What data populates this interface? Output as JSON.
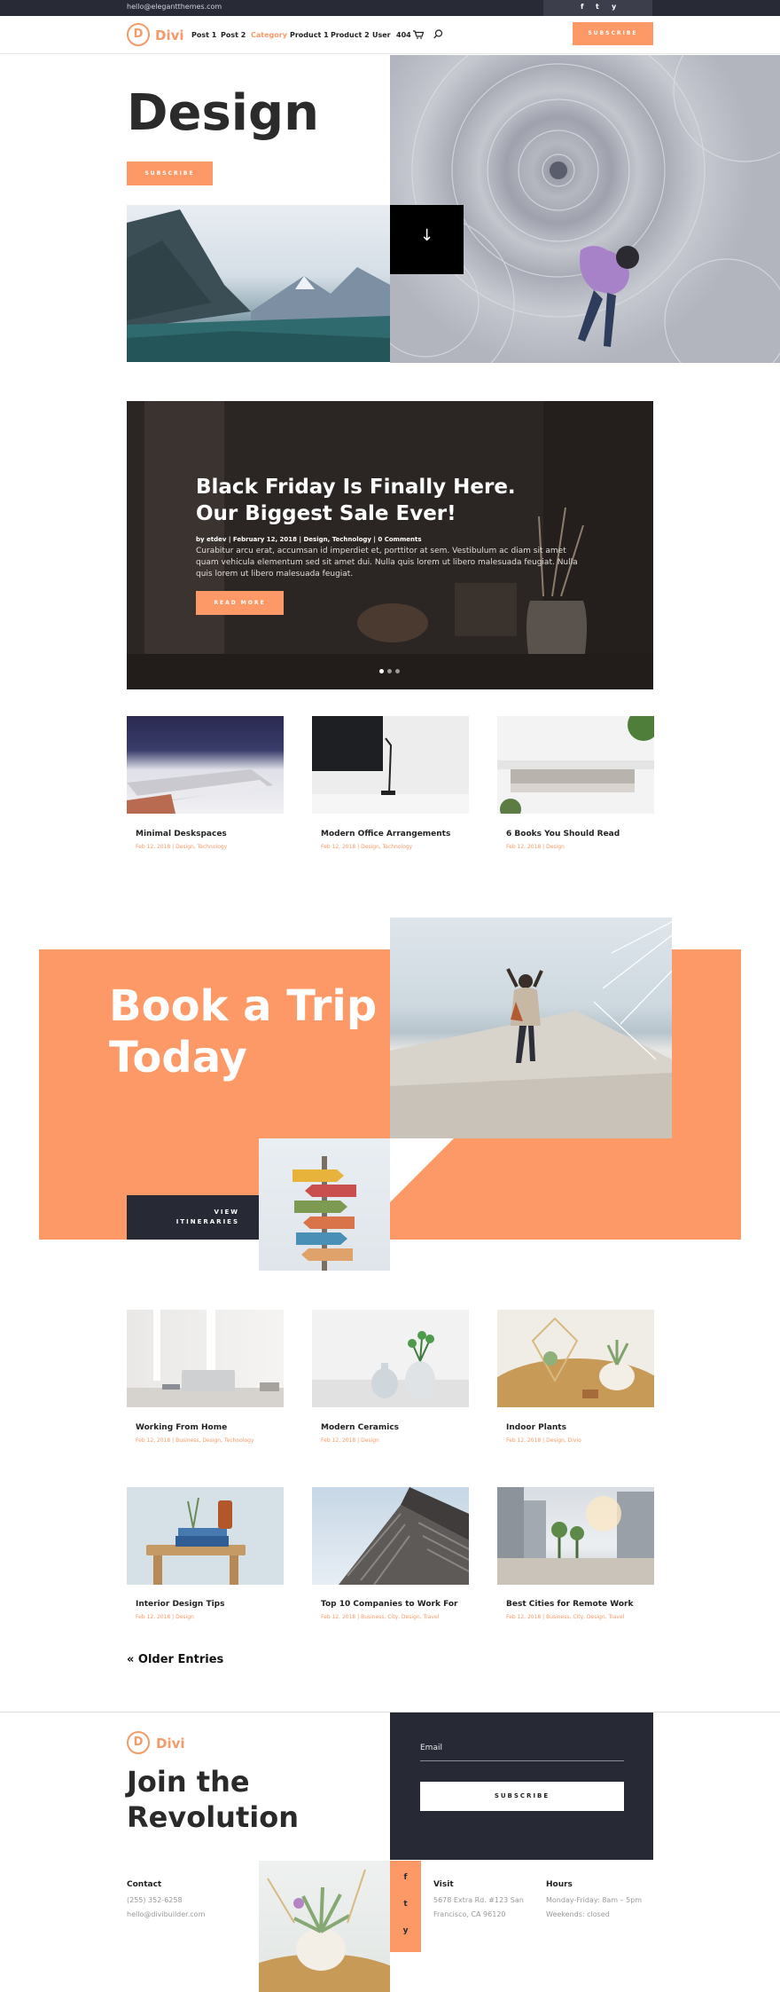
{
  "topbar": {
    "email": "hello@elegantthemes.com",
    "social": [
      "f",
      "t",
      "y"
    ]
  },
  "header": {
    "logo_letter": "D",
    "logo_text": "Divi",
    "nav": [
      "Post 1",
      "Post 2",
      "Category",
      "Product 1",
      "Product 2",
      "User",
      "404"
    ],
    "active_nav": "Category",
    "subscribe_label": "SUBSCRIBE"
  },
  "hero": {
    "title": "Design",
    "subscribe_label": "SUBSCRIBE",
    "arrow": "↓"
  },
  "featured": {
    "title": "Black Friday Is Finally Here. Our Biggest Sale Ever!",
    "meta": "by etdev | February 12, 2018 | Design, Technology | 0 Comments",
    "excerpt": "Curabitur arcu erat, accumsan id imperdiet et, porttitor at sem. Vestibulum ac diam sit amet quam vehicula elementum sed sit amet dui. Nulla quis lorem ut libero malesuada feugiat. Nulla quis lorem ut libero malesuada feugiat.",
    "button_label": "READ MORE"
  },
  "posts_row1": [
    {
      "title": "Minimal Deskspaces",
      "meta": "Feb 12, 2018 | Design, Technology"
    },
    {
      "title": "Modern Office Arrangements",
      "meta": "Feb 12, 2018 | Design, Technology"
    },
    {
      "title": "6 Books You Should Read",
      "meta": "Feb 12, 2018 | Design"
    }
  ],
  "trip": {
    "title": "Book a Trip Today",
    "button_line1": "VIEW",
    "button_line2": "ITINERARIES"
  },
  "posts_row2": [
    {
      "title": "Working From Home",
      "meta": "Feb 12, 2018 | Business, Design, Technology"
    },
    {
      "title": "Modern Ceramics",
      "meta": "Feb 12, 2018 | Design"
    },
    {
      "title": "Indoor Plants",
      "meta": "Feb 12, 2018 | Design, Divio"
    }
  ],
  "posts_row3": [
    {
      "title": "Interior Design Tips",
      "meta": "Feb 12, 2018 | Design"
    },
    {
      "title": "Top 10 Companies to Work For",
      "meta": "Feb 12, 2018 | Business, City, Design, Travel"
    },
    {
      "title": "Best Cities for Remote Work",
      "meta": "Feb 12, 2018 | Business, City, Design, Travel"
    }
  ],
  "older_entries": "« Older Entries",
  "footer": {
    "logo_letter": "D",
    "logo_text": "Divi",
    "join_line1": "Join the",
    "join_line2": "Revolution",
    "email_placeholder": "Email",
    "subscribe_label": "SUBSCRIBE",
    "contact_label": "Contact",
    "contact_phone": "(255) 352-6258",
    "contact_email": "hello@divibuilder.com",
    "social": [
      "f",
      "t",
      "y"
    ],
    "visit_label": "Visit",
    "visit_line1": "5678 Extra Rd. #123 San",
    "visit_line2": "Francisco, CA 96120",
    "hours_label": "Hours",
    "hours_line1": "Monday-Friday: 8am – 5pm",
    "hours_line2": "Weekends: closed"
  },
  "colors": {
    "accent": "#fc9966",
    "dark": "#272a35"
  }
}
